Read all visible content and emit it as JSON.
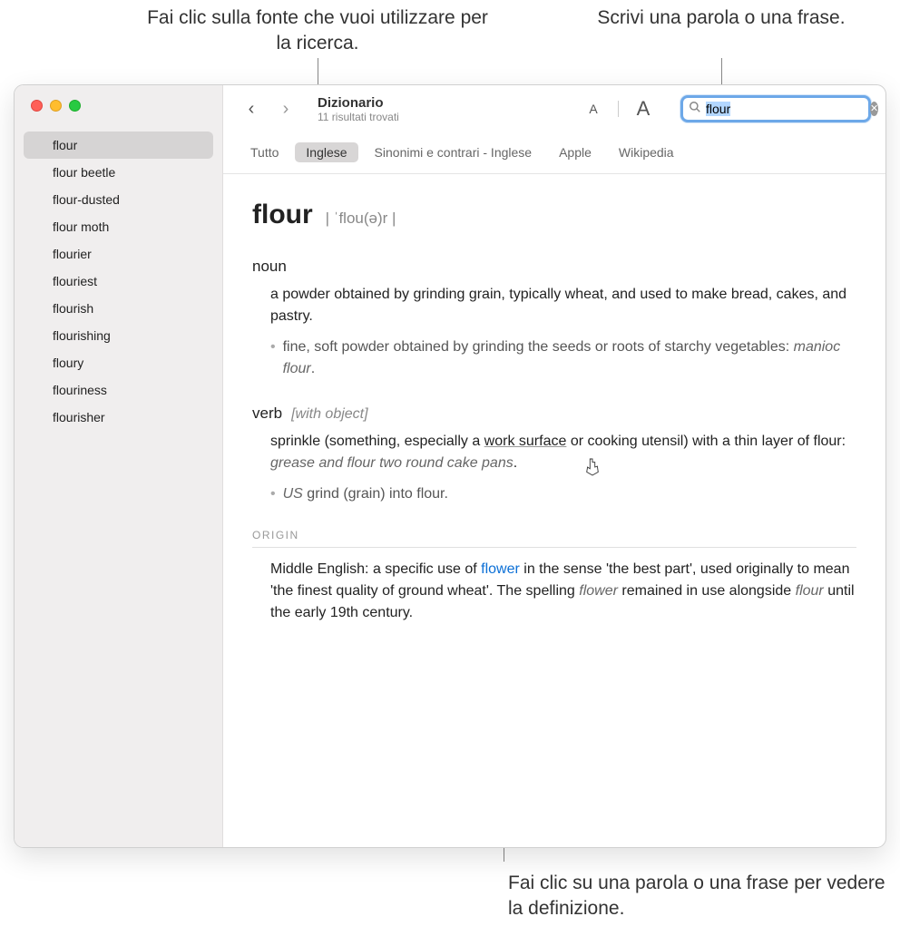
{
  "callouts": {
    "source": "Fai clic sulla fonte che vuoi utilizzare per la ricerca.",
    "search": "Scrivi una parola o una frase.",
    "word": "Fai clic su una parola o una frase per vedere la definizione."
  },
  "toolbar": {
    "title": "Dizionario",
    "subtitle": "11 risultati trovati"
  },
  "search": {
    "value": "flour"
  },
  "sidebar": {
    "items": [
      "flour",
      "flour beetle",
      "flour-dusted",
      "flour moth",
      "flourier",
      "flouriest",
      "flourish",
      "flourishing",
      "floury",
      "flouriness",
      "flourisher"
    ]
  },
  "tabs": {
    "items": [
      "Tutto",
      "Inglese",
      "Sinonimi e contrari - Inglese",
      "Apple",
      "Wikipedia"
    ],
    "selected": 1
  },
  "entry": {
    "headword": "flour",
    "pronunciation": "| ˈflou(ə)r |",
    "noun_label": "noun",
    "noun_def": "a powder obtained by grinding grain, typically wheat, and used to make bread, cakes, and pastry.",
    "noun_sub": "fine, soft powder obtained by grinding the seeds or roots of starchy vegetables:",
    "noun_example": "manioc flour",
    "verb_label": "verb",
    "verb_note": "[with object]",
    "verb_def_pre": "sprinkle (something, especially a ",
    "verb_def_link": "work surface",
    "verb_def_post": " or cooking utensil) with a thin layer of flour:",
    "verb_example": "grease and flour two round cake pans",
    "verb_sub_region": "US",
    "verb_sub": "grind (grain) into flour.",
    "origin_label": "ORIGIN",
    "origin_pre": "Middle English: a specific use of ",
    "origin_link": "flower",
    "origin_mid": " in the sense 'the best part', used originally to mean 'the finest quality of ground wheat'. The spelling ",
    "origin_em1": "flower",
    "origin_mid2": " remained in use alongside ",
    "origin_em2": "flour",
    "origin_post": " until the early 19th century."
  }
}
